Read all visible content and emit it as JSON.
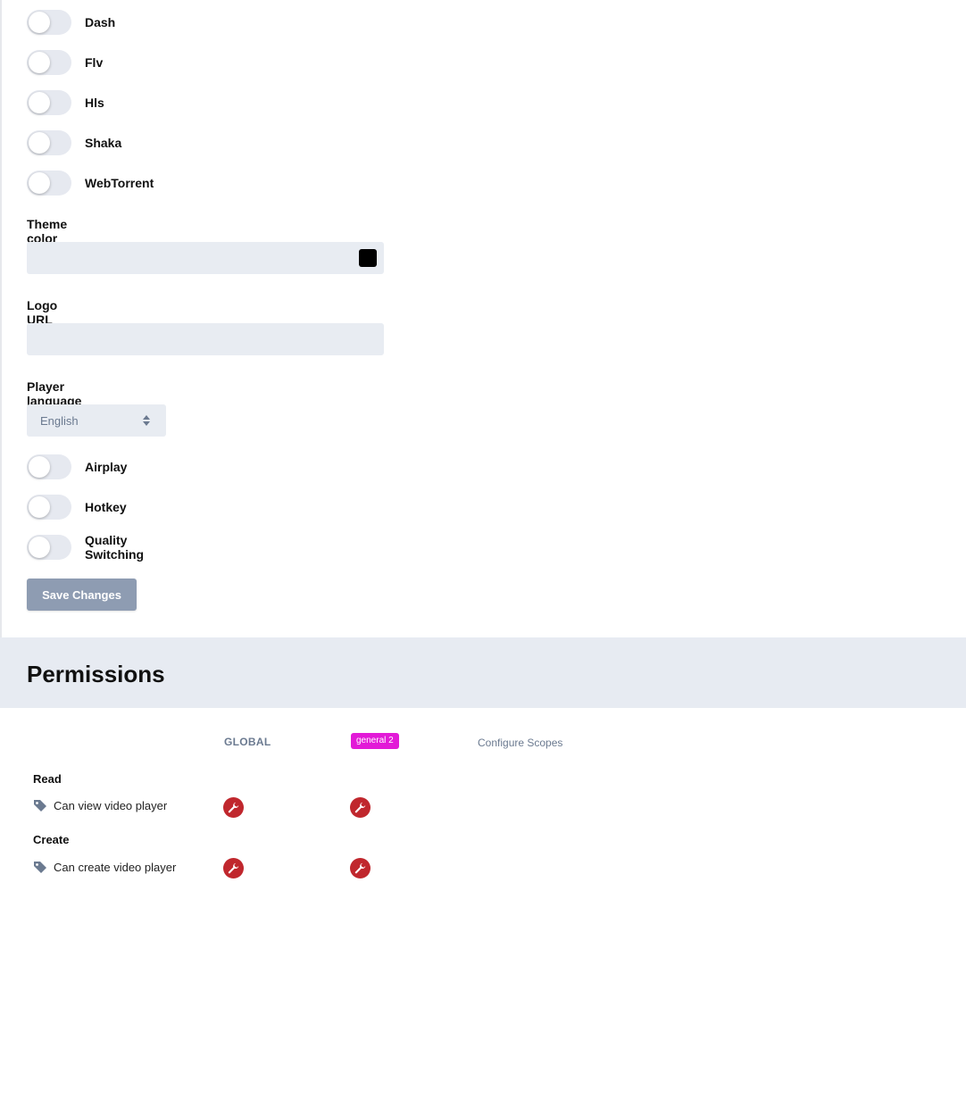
{
  "toggles_top": [
    {
      "label": "Dash",
      "on": false
    },
    {
      "label": "Flv",
      "on": false
    },
    {
      "label": "Hls",
      "on": false
    },
    {
      "label": "Shaka",
      "on": false
    },
    {
      "label": "WebTorrent",
      "on": false
    }
  ],
  "theme_color": {
    "label": "Theme color",
    "value": "",
    "swatch_color": "#000000"
  },
  "logo_url": {
    "label": "Logo URL",
    "value": ""
  },
  "player_language": {
    "label": "Player language",
    "selected": "English"
  },
  "toggles_bottom": [
    {
      "label": "Airplay",
      "on": false
    },
    {
      "label": "Hotkey",
      "on": false
    },
    {
      "label": "Quality Switching",
      "on": false
    }
  ],
  "save_button": {
    "label": "Save Changes"
  },
  "permissions": {
    "title": "Permissions",
    "columns": {
      "global": "GLOBAL",
      "scope_badge": "general 2",
      "scope_badge_color": "#e21ad7",
      "configure_link": "Configure Scopes"
    },
    "groups": [
      {
        "title": "Read",
        "items": [
          {
            "label": "Can view video player",
            "icon": "tag-icon",
            "actions": [
              "wrench-icon",
              "wrench-icon"
            ]
          }
        ]
      },
      {
        "title": "Create",
        "items": [
          {
            "label": "Can create video player",
            "icon": "tag-icon",
            "actions": [
              "wrench-icon",
              "wrench-icon"
            ]
          }
        ]
      }
    ],
    "action_color": "#c0272d"
  }
}
